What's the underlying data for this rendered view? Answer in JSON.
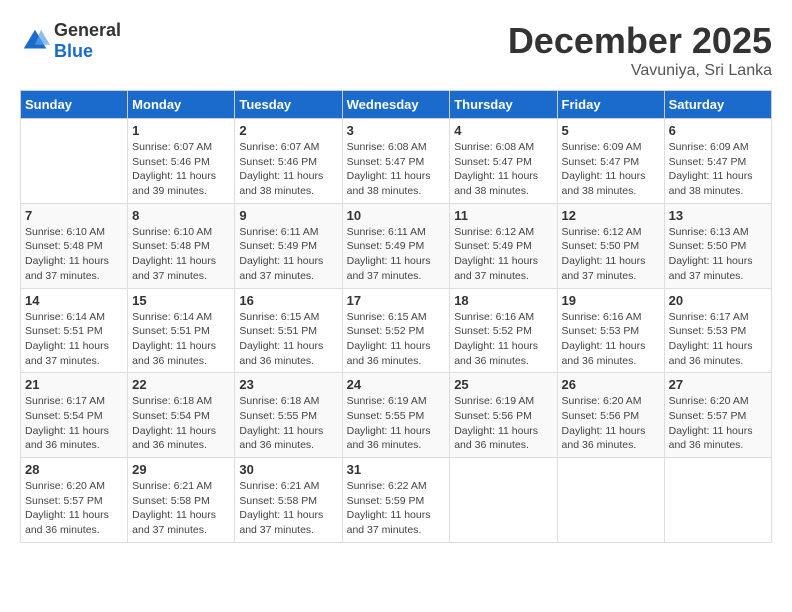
{
  "logo": {
    "general": "General",
    "blue": "Blue"
  },
  "header": {
    "month": "December 2025",
    "location": "Vavuniya, Sri Lanka"
  },
  "weekdays": [
    "Sunday",
    "Monday",
    "Tuesday",
    "Wednesday",
    "Thursday",
    "Friday",
    "Saturday"
  ],
  "weeks": [
    [
      {
        "day": "",
        "sunrise": "",
        "sunset": "",
        "daylight": ""
      },
      {
        "day": "1",
        "sunrise": "Sunrise: 6:07 AM",
        "sunset": "Sunset: 5:46 PM",
        "daylight": "Daylight: 11 hours and 39 minutes."
      },
      {
        "day": "2",
        "sunrise": "Sunrise: 6:07 AM",
        "sunset": "Sunset: 5:46 PM",
        "daylight": "Daylight: 11 hours and 38 minutes."
      },
      {
        "day": "3",
        "sunrise": "Sunrise: 6:08 AM",
        "sunset": "Sunset: 5:47 PM",
        "daylight": "Daylight: 11 hours and 38 minutes."
      },
      {
        "day": "4",
        "sunrise": "Sunrise: 6:08 AM",
        "sunset": "Sunset: 5:47 PM",
        "daylight": "Daylight: 11 hours and 38 minutes."
      },
      {
        "day": "5",
        "sunrise": "Sunrise: 6:09 AM",
        "sunset": "Sunset: 5:47 PM",
        "daylight": "Daylight: 11 hours and 38 minutes."
      },
      {
        "day": "6",
        "sunrise": "Sunrise: 6:09 AM",
        "sunset": "Sunset: 5:47 PM",
        "daylight": "Daylight: 11 hours and 38 minutes."
      }
    ],
    [
      {
        "day": "7",
        "sunrise": "Sunrise: 6:10 AM",
        "sunset": "Sunset: 5:48 PM",
        "daylight": "Daylight: 11 hours and 37 minutes."
      },
      {
        "day": "8",
        "sunrise": "Sunrise: 6:10 AM",
        "sunset": "Sunset: 5:48 PM",
        "daylight": "Daylight: 11 hours and 37 minutes."
      },
      {
        "day": "9",
        "sunrise": "Sunrise: 6:11 AM",
        "sunset": "Sunset: 5:49 PM",
        "daylight": "Daylight: 11 hours and 37 minutes."
      },
      {
        "day": "10",
        "sunrise": "Sunrise: 6:11 AM",
        "sunset": "Sunset: 5:49 PM",
        "daylight": "Daylight: 11 hours and 37 minutes."
      },
      {
        "day": "11",
        "sunrise": "Sunrise: 6:12 AM",
        "sunset": "Sunset: 5:49 PM",
        "daylight": "Daylight: 11 hours and 37 minutes."
      },
      {
        "day": "12",
        "sunrise": "Sunrise: 6:12 AM",
        "sunset": "Sunset: 5:50 PM",
        "daylight": "Daylight: 11 hours and 37 minutes."
      },
      {
        "day": "13",
        "sunrise": "Sunrise: 6:13 AM",
        "sunset": "Sunset: 5:50 PM",
        "daylight": "Daylight: 11 hours and 37 minutes."
      }
    ],
    [
      {
        "day": "14",
        "sunrise": "Sunrise: 6:14 AM",
        "sunset": "Sunset: 5:51 PM",
        "daylight": "Daylight: 11 hours and 37 minutes."
      },
      {
        "day": "15",
        "sunrise": "Sunrise: 6:14 AM",
        "sunset": "Sunset: 5:51 PM",
        "daylight": "Daylight: 11 hours and 36 minutes."
      },
      {
        "day": "16",
        "sunrise": "Sunrise: 6:15 AM",
        "sunset": "Sunset: 5:51 PM",
        "daylight": "Daylight: 11 hours and 36 minutes."
      },
      {
        "day": "17",
        "sunrise": "Sunrise: 6:15 AM",
        "sunset": "Sunset: 5:52 PM",
        "daylight": "Daylight: 11 hours and 36 minutes."
      },
      {
        "day": "18",
        "sunrise": "Sunrise: 6:16 AM",
        "sunset": "Sunset: 5:52 PM",
        "daylight": "Daylight: 11 hours and 36 minutes."
      },
      {
        "day": "19",
        "sunrise": "Sunrise: 6:16 AM",
        "sunset": "Sunset: 5:53 PM",
        "daylight": "Daylight: 11 hours and 36 minutes."
      },
      {
        "day": "20",
        "sunrise": "Sunrise: 6:17 AM",
        "sunset": "Sunset: 5:53 PM",
        "daylight": "Daylight: 11 hours and 36 minutes."
      }
    ],
    [
      {
        "day": "21",
        "sunrise": "Sunrise: 6:17 AM",
        "sunset": "Sunset: 5:54 PM",
        "daylight": "Daylight: 11 hours and 36 minutes."
      },
      {
        "day": "22",
        "sunrise": "Sunrise: 6:18 AM",
        "sunset": "Sunset: 5:54 PM",
        "daylight": "Daylight: 11 hours and 36 minutes."
      },
      {
        "day": "23",
        "sunrise": "Sunrise: 6:18 AM",
        "sunset": "Sunset: 5:55 PM",
        "daylight": "Daylight: 11 hours and 36 minutes."
      },
      {
        "day": "24",
        "sunrise": "Sunrise: 6:19 AM",
        "sunset": "Sunset: 5:55 PM",
        "daylight": "Daylight: 11 hours and 36 minutes."
      },
      {
        "day": "25",
        "sunrise": "Sunrise: 6:19 AM",
        "sunset": "Sunset: 5:56 PM",
        "daylight": "Daylight: 11 hours and 36 minutes."
      },
      {
        "day": "26",
        "sunrise": "Sunrise: 6:20 AM",
        "sunset": "Sunset: 5:56 PM",
        "daylight": "Daylight: 11 hours and 36 minutes."
      },
      {
        "day": "27",
        "sunrise": "Sunrise: 6:20 AM",
        "sunset": "Sunset: 5:57 PM",
        "daylight": "Daylight: 11 hours and 36 minutes."
      }
    ],
    [
      {
        "day": "28",
        "sunrise": "Sunrise: 6:20 AM",
        "sunset": "Sunset: 5:57 PM",
        "daylight": "Daylight: 11 hours and 36 minutes."
      },
      {
        "day": "29",
        "sunrise": "Sunrise: 6:21 AM",
        "sunset": "Sunset: 5:58 PM",
        "daylight": "Daylight: 11 hours and 37 minutes."
      },
      {
        "day": "30",
        "sunrise": "Sunrise: 6:21 AM",
        "sunset": "Sunset: 5:58 PM",
        "daylight": "Daylight: 11 hours and 37 minutes."
      },
      {
        "day": "31",
        "sunrise": "Sunrise: 6:22 AM",
        "sunset": "Sunset: 5:59 PM",
        "daylight": "Daylight: 11 hours and 37 minutes."
      },
      {
        "day": "",
        "sunrise": "",
        "sunset": "",
        "daylight": ""
      },
      {
        "day": "",
        "sunrise": "",
        "sunset": "",
        "daylight": ""
      },
      {
        "day": "",
        "sunrise": "",
        "sunset": "",
        "daylight": ""
      }
    ]
  ]
}
